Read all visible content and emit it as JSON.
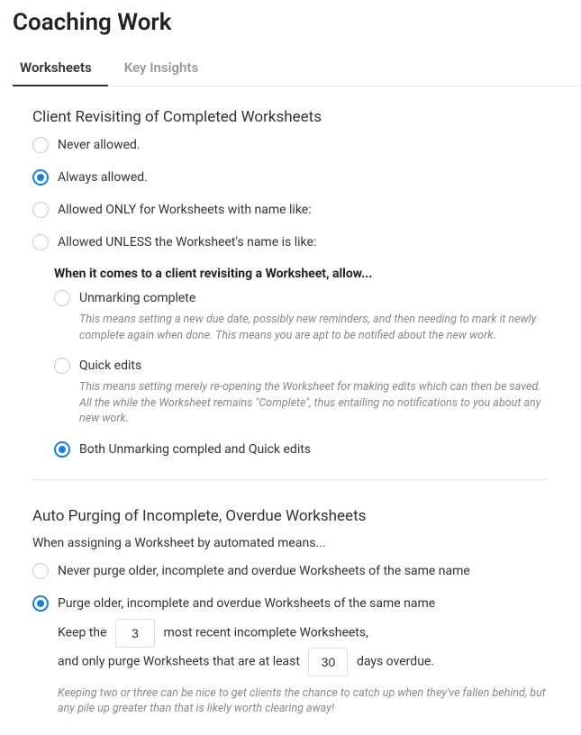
{
  "title": "Coaching Work",
  "tabs": [
    {
      "label": "Worksheets",
      "active": true
    },
    {
      "label": "Key Insights",
      "active": false
    }
  ],
  "revisiting": {
    "heading": "Client Revisiting of Completed Worksheets",
    "options": {
      "never": "Never allowed.",
      "always": "Always allowed.",
      "only_named": "Allowed ONLY for Worksheets with name like:",
      "unless_named": "Allowed UNLESS the Worksheet's name is like:"
    },
    "sub": {
      "heading": "When it comes to a client revisiting a Worksheet, allow...",
      "unmarking": {
        "label": "Unmarking complete",
        "help": "This means setting a new due date, possibly new reminders, and then needing to mark it newly complete again when done. This means you are apt to be notified about the new work."
      },
      "quick": {
        "label": "Quick edits",
        "help": "This means setting merely re-opening the Worksheet for making edits which can then be saved. All the while the Worksheet remains \"Complete\", thus entailing no notifications to you about any new work."
      },
      "both": {
        "label": "Both Unmarking compled and Quick edits"
      }
    }
  },
  "purging": {
    "heading": "Auto Purging of Incomplete, Overdue Worksheets",
    "sub": "When assigning a Worksheet by automated means...",
    "options": {
      "never": "Never purge older, incomplete and overdue Worksheets of the same name",
      "purge": "Purge older, incomplete and overdue Worksheets of the same name"
    },
    "keep_prefix": "Keep the",
    "keep_value": "3",
    "keep_suffix": "most recent incomplete Worksheets,",
    "days_prefix": "and only purge Worksheets that are at least",
    "days_value": "30",
    "days_suffix": "days overdue.",
    "help": "Keeping two or three can be nice to get clients the chance to catch up when they've fallen behind, but any pile up greater than that is likely worth clearing away!"
  }
}
